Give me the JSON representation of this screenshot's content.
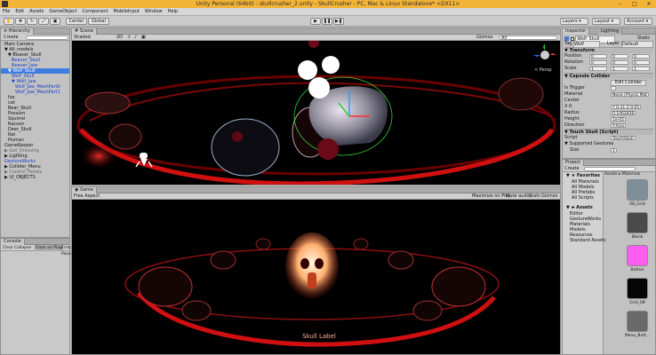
{
  "window": {
    "title": "Unity Personal (64bit) - skullcrusher_2.unity - SkullCrusher - PC, Mac & Linux Standalone* <DX11>"
  },
  "menu": [
    "File",
    "Edit",
    "Assets",
    "GameObject",
    "Component",
    "MobileInput",
    "Window",
    "Help"
  ],
  "toolbar": {
    "center": "Center",
    "global": "Global",
    "layers": "Layers",
    "layout": "Layout",
    "account": "Account"
  },
  "hierarchy": {
    "tab": "Hierarchy",
    "create": "Create",
    "items": [
      {
        "label": "Main Camera",
        "style": "normal",
        "indent": 1
      },
      {
        "label": "▼ All_models",
        "style": "normal",
        "indent": 1
      },
      {
        "label": "▼ Beaver_Skull",
        "style": "normal",
        "indent": 2
      },
      {
        "label": "Beaver_Skull",
        "style": "blue",
        "indent": 3
      },
      {
        "label": "Beaver_Jaw",
        "style": "blue",
        "indent": 3
      },
      {
        "label": "▼ Wolf_Skull",
        "style": "sel",
        "indent": 2
      },
      {
        "label": "Wolf_Skull",
        "style": "blue",
        "indent": 3
      },
      {
        "label": "▼ Wolf_Jaw",
        "style": "blue",
        "indent": 3
      },
      {
        "label": "Wolf_Jaw_MeshPart0",
        "style": "blue",
        "indent": 4
      },
      {
        "label": "Wolf_Jaw_MeshPart1",
        "style": "blue",
        "indent": 4
      },
      {
        "label": "fox",
        "style": "normal",
        "indent": 2
      },
      {
        "label": "cat",
        "style": "normal",
        "indent": 2
      },
      {
        "label": "Bear_Skull",
        "style": "normal",
        "indent": 2
      },
      {
        "label": "Possum",
        "style": "normal",
        "indent": 2
      },
      {
        "label": "Squirrel",
        "style": "normal",
        "indent": 2
      },
      {
        "label": "Racoon",
        "style": "normal",
        "indent": 2
      },
      {
        "label": "Deer_Skull",
        "style": "normal",
        "indent": 2
      },
      {
        "label": "Rat",
        "style": "normal",
        "indent": 2
      },
      {
        "label": "Human",
        "style": "normal",
        "indent": 2
      },
      {
        "label": "GameKeeper",
        "style": "normal",
        "indent": 1
      },
      {
        "label": "▶ Get_Dressing",
        "style": "gray",
        "indent": 1
      },
      {
        "label": "▶ Lighting",
        "style": "normal",
        "indent": 1
      },
      {
        "label": "GestureWorks",
        "style": "blue",
        "indent": 1
      },
      {
        "label": "▶ Collider_Menu",
        "style": "normal",
        "indent": 1
      },
      {
        "label": "▶ Control_Panels",
        "style": "gray",
        "indent": 1
      },
      {
        "label": "▶ UI_OBJECTS",
        "style": "normal",
        "indent": 1
      }
    ]
  },
  "console": {
    "tab": "Console",
    "clear": "Clear",
    "collapse": "Collapse",
    "clear_on_play": "Clear on Play",
    "error_pause": "Error Pause"
  },
  "scene": {
    "tab": "Scene",
    "shading": "Shaded",
    "mode": "2D",
    "gizmos": "Gizmos",
    "search": "All",
    "persp": "< Persp"
  },
  "game": {
    "tab": "Game",
    "aspect": "Free Aspect",
    "maximize": "Maximize on Play",
    "mute": "Mute audio",
    "stats": "Stats",
    "gizmos": "Gizmos",
    "skull_label": "Skull Label"
  },
  "inspector": {
    "tabs": [
      "Inspector",
      "Lighting"
    ],
    "object_name": "Wolf_Skull",
    "static": "Static",
    "tag_label": "Tag",
    "tag": "Wolf",
    "layer_label": "Layer",
    "layer": "Default",
    "transform": {
      "title": "Transform",
      "rows": [
        {
          "label": "Position",
          "x": "0",
          "y": "0",
          "z": "0"
        },
        {
          "label": "Rotation",
          "x": "0",
          "y": "0",
          "z": "0"
        },
        {
          "label": "Scale",
          "x": "1",
          "y": "1",
          "z": "1"
        }
      ]
    },
    "collider": {
      "title": "Capsule Collider",
      "edit": "Edit Collider",
      "rows": [
        {
          "label": "Is Trigger",
          "value": ""
        },
        {
          "label": "Material",
          "value": "None (Physic Mat"
        },
        {
          "label": "Center",
          "value": ""
        },
        {
          "label": "X  0",
          "value": "Y 0.31   Z 0.05"
        },
        {
          "label": "Radius",
          "value": "0.1062836"
        },
        {
          "label": "Height",
          "value": "1e-05"
        },
        {
          "label": "Direction",
          "value": "Y-Axis"
        }
      ]
    },
    "script": {
      "title": "Touch Skull (Script)",
      "script_label": "Script",
      "script": "TouchSkull",
      "gestures": "Supported Gestures",
      "size_label": "Size",
      "size": "1"
    }
  },
  "project": {
    "tab": "Project",
    "create": "Create",
    "breadcrumb": "Assets ▸ Materials",
    "favorites": {
      "title": "Favorites",
      "items": [
        "All Materials",
        "All Models",
        "All Prefabs",
        "All Scripts"
      ]
    },
    "assets": {
      "title": "Assets",
      "items": [
        "Editor",
        "GestureWorks",
        "Materials",
        "Models",
        "Resources",
        "Standard Assets"
      ]
    },
    "thumbs": [
      {
        "name": "08_Grid",
        "color": "#7f8f9a"
      },
      {
        "name": "Blank",
        "color": "#4a4a4a"
      },
      {
        "name": "Button",
        "color": "#ff5cf4"
      },
      {
        "name": "Grid_08",
        "color": "#050505"
      },
      {
        "name": "Menu_Butt...",
        "color": "#6a6a6a"
      }
    ]
  },
  "colors": {
    "title_bar": "#f3b336",
    "selection": "#3e7ce0",
    "ring": "#d01010"
  }
}
